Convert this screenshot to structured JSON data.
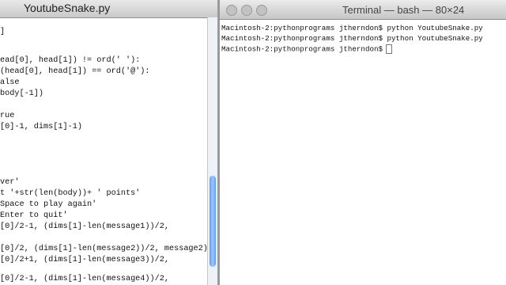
{
  "editor": {
    "title": "YoutubeSnake.py",
    "code_lines": [
      "]",
      "ead[0], head[1]) != ord(' '):",
      "(head[0], head[1]) == ord('@'):",
      "alse",
      "body[-1])",
      "",
      "rue",
      "[0]-1, dims[1]-1)",
      "",
      "",
      "",
      "",
      "ver'",
      "t '+str(len(body))+ ' points'",
      "Space to play again'",
      "Enter to quit'",
      "[0]/2-1, (dims[1]-len(message1))/2,",
      "",
      "[0]/2, (dims[1]-len(message2))/2, message2)",
      "[0]/2+1, (dims[1]-len(message3))/2,",
      "",
      "[0]/2-1, (dims[1]-len(message4))/2,"
    ]
  },
  "terminal": {
    "title": "Terminal — bash — 80×24",
    "lines": [
      "Macintosh-2:pythonprograms jtherndon$ python YoutubeSnake.py",
      "Macintosh-2:pythonprograms jtherndon$ python YoutubeSnake.py",
      "Macintosh-2:pythonprograms jtherndon$"
    ]
  }
}
